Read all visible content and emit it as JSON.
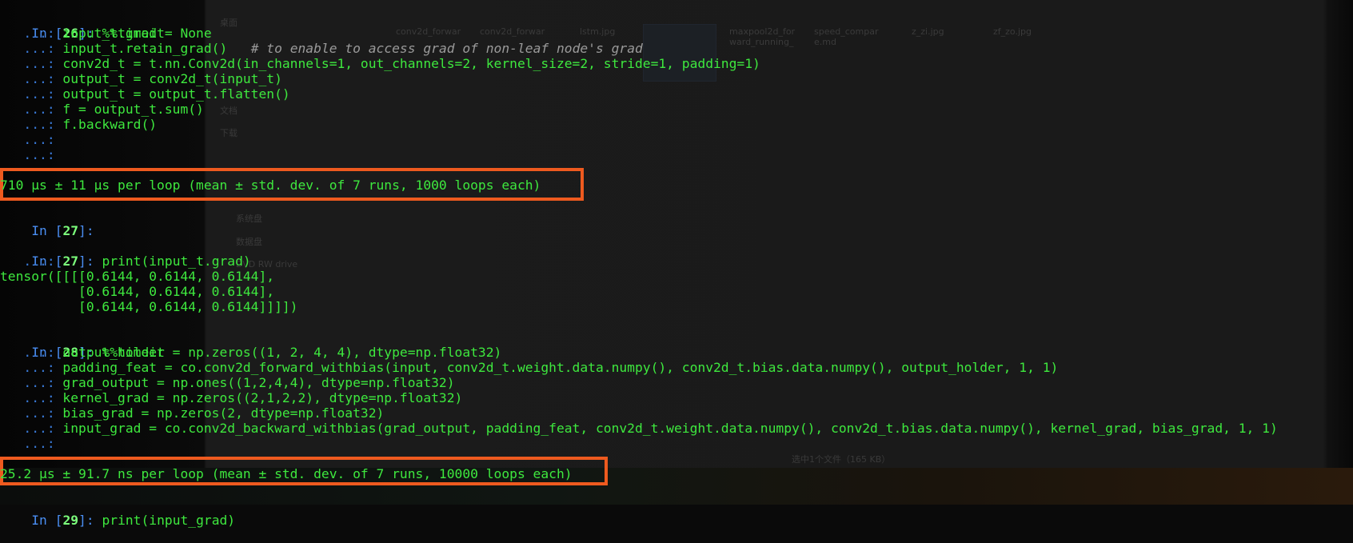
{
  "desktop_ghost": {
    "sidebar_items": [
      "桌面",
      "文档",
      "下载",
      "系统盘",
      "数据盘",
      "DVD RW drive"
    ],
    "files": [
      "conv2d_forwar",
      "conv2d_forwar",
      "lstm.jpg",
      "maxpool2d_for ward_running_",
      "speed_compar e.md",
      "z_zi.jpg",
      "zf_zo.jpg"
    ],
    "status_text": "选中1个文件（165 KB）"
  },
  "cells": [
    {
      "in_label": "In [",
      "number": "26",
      "close": "]: ",
      "lines": [
        "%%timeit",
        "input_t.grad = None",
        "input_t.retain_grad()",
        "conv2d_t = t.nn.Conv2d(in_channels=1, out_channels=2, kernel_size=2, stride=1, padding=1)",
        "output_t = conv2d_t(input_t)",
        "output_t = output_t.flatten()",
        "f = output_t.sum()",
        "f.backward()"
      ],
      "comment_line_index": 2,
      "comment": "   # to enable to access grad of non-leaf node's grad",
      "output": "710 µs ± 11 µs per loop (mean ± std. dev. of 7 runs, 1000 loops each)"
    },
    {
      "in_label": "In [",
      "number": "27",
      "close": "]: "
    },
    {
      "in_label": "In [",
      "number": "27",
      "close": "]: ",
      "lines": [
        "print(input_t.grad)"
      ],
      "output_lines": [
        "tensor([[[[0.6144, 0.6144, 0.6144],",
        "          [0.6144, 0.6144, 0.6144],",
        "          [0.6144, 0.6144, 0.6144]]]])"
      ]
    },
    {
      "in_label": "In [",
      "number": "28",
      "close": "]: ",
      "lines": [
        "%%timeit",
        "output_holder = np.zeros((1, 2, 4, 4), dtype=np.float32)",
        "padding_feat = co.conv2d_forward_withbias(input, conv2d_t.weight.data.numpy(), conv2d_t.bias.data.numpy(), output_holder, 1, 1)",
        "grad_output = np.ones((1,2,4,4), dtype=np.float32)",
        "kernel_grad = np.zeros((2,1,2,2), dtype=np.float32)",
        "bias_grad = np.zeros(2, dtype=np.float32)",
        "input_grad = co.conv2d_backward_withbias(grad_output, padding_feat, conv2d_t.weight.data.numpy(), conv2d_t.bias.data.numpy(), kernel_grad, bias_grad, 1, 1)"
      ],
      "output": "25.2 µs ± 91.7 ns per loop (mean ± std. dev. of 7 runs, 10000 loops each)"
    },
    {
      "in_label": "In [",
      "number": "29",
      "close": "]: ",
      "lines": [
        "print(input_grad)"
      ]
    }
  ],
  "continuation": "   ...: ",
  "highlight_color": "#ee5a1f"
}
